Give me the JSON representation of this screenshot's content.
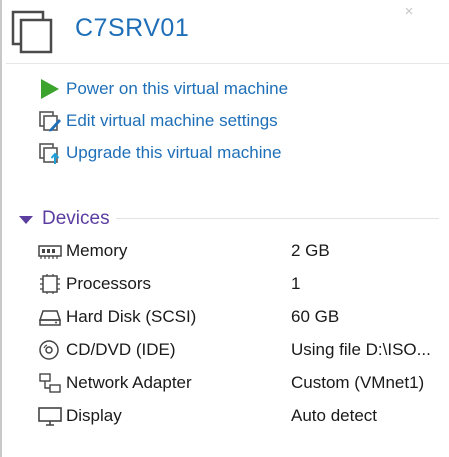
{
  "vm": {
    "name": "C7SRV01"
  },
  "actions": [
    {
      "icon": "play-icon",
      "label": "Power on this virtual machine"
    },
    {
      "icon": "edit-settings-icon",
      "label": "Edit virtual machine settings"
    },
    {
      "icon": "upgrade-icon",
      "label": "Upgrade this virtual machine"
    }
  ],
  "devices": {
    "title": "Devices",
    "items": [
      {
        "icon": "memory-icon",
        "name": "Memory",
        "value": "2 GB"
      },
      {
        "icon": "processor-icon",
        "name": "Processors",
        "value": "1"
      },
      {
        "icon": "hard-disk-icon",
        "name": "Hard Disk (SCSI)",
        "value": "60 GB"
      },
      {
        "icon": "cd-dvd-icon",
        "name": "CD/DVD (IDE)",
        "value": "Using file D:\\ISO..."
      },
      {
        "icon": "network-adapter-icon",
        "name": "Network Adapter",
        "value": "Custom (VMnet1)"
      },
      {
        "icon": "display-icon",
        "name": "Display",
        "value": "Auto detect"
      }
    ]
  },
  "colors": {
    "link": "#1e6fb8",
    "section_title": "#5b3ea0",
    "play_green": "#3aa42d",
    "text": "#1a1a1a"
  }
}
